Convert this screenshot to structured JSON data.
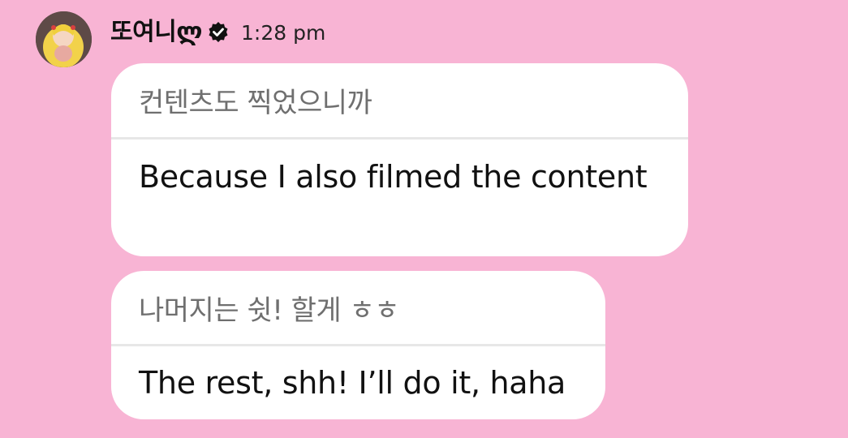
{
  "header": {
    "sender_name": "또여니ლ",
    "timestamp": "1:28 pm",
    "verified_icon": "verified-check-icon"
  },
  "colors": {
    "background": "#f8b4d4",
    "bubble": "#ffffff",
    "divider": "#e7e7e7",
    "korean_text": "#6f6f6f",
    "english_text": "#111111"
  },
  "messages": [
    {
      "original": "컨텐츠도 찍었으니까",
      "translation": "Because I also filmed the content"
    },
    {
      "original": "나머지는 쉿! 할게 ㅎㅎ",
      "translation": "The rest, shh! I’ll do it, haha"
    }
  ]
}
